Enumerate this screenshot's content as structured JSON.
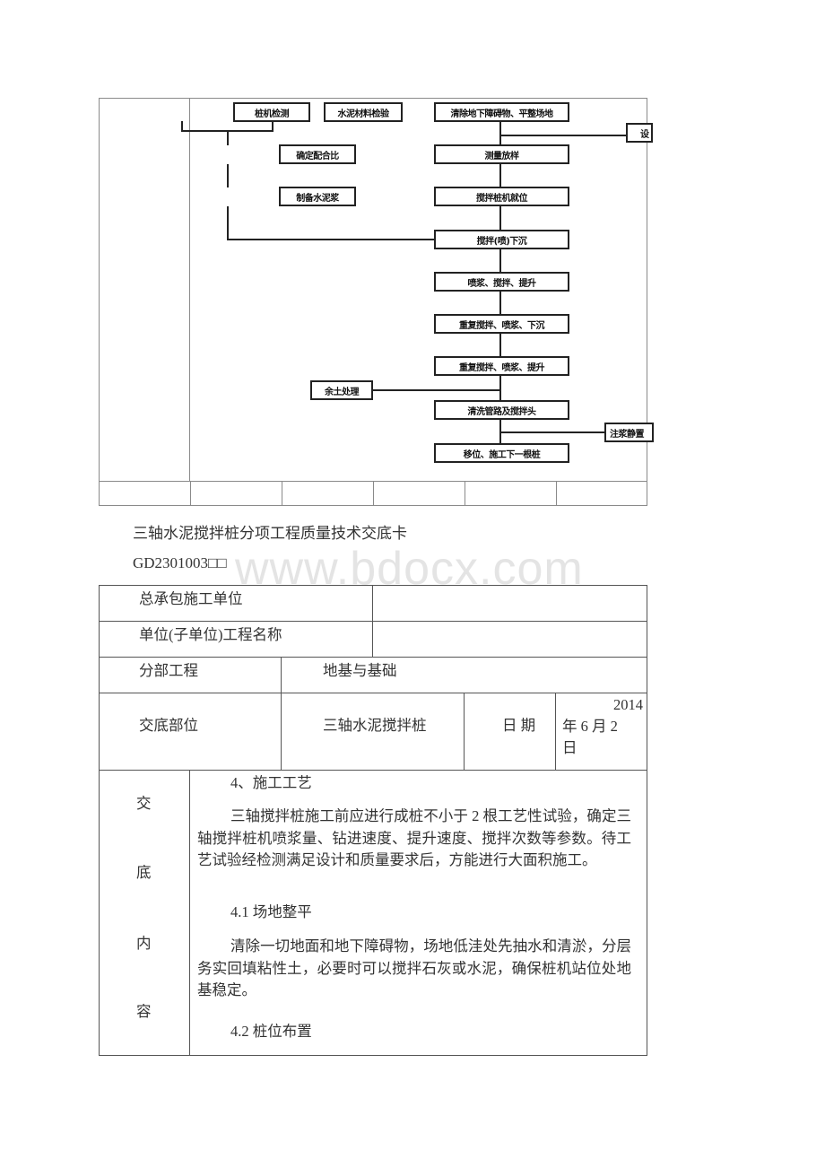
{
  "flowchart": {
    "boxes": {
      "pile_machine_check": "桩机检测",
      "cement_material_check": "水泥材料检验",
      "clear_obstacles": "清除地下障碍物、平整场地",
      "side_right_top": "设",
      "mix_ratio": "确定配合比",
      "survey_layout": "测量放样",
      "prepare_slurry": "制备水泥浆",
      "machine_in_place": "搅拌桩机就位",
      "mix_sink": "搅拌(喷)下沉",
      "spray_mix_lift": "喷浆、搅拌、提升",
      "repeat_mix_sink": "重复搅拌、喷浆、下沉",
      "repeat_mix_lift": "重复搅拌、喷浆、提升",
      "spoil_disposal": "余土处理",
      "clean_pipes": "清洗管路及搅拌头",
      "side_right_bottom": "注浆静置",
      "move_next": "移位、施工下一根桩"
    }
  },
  "document": {
    "title": "三轴水泥搅拌桩分项工程质量技术交底卡",
    "code": "GD2301003□□",
    "watermark": "www.bdocx.com"
  },
  "form": {
    "general_contractor_label": "总承包施工单位",
    "general_contractor_value": "",
    "project_name_label": "单位(子单位)工程名称",
    "project_name_value": "",
    "sub_project_label": "分部工程",
    "sub_project_value": "地基与基础",
    "location_label": "交底部位",
    "location_value": "三轴水泥搅拌桩",
    "date_label": "日 期",
    "date_line1": "2014",
    "date_line2": "年 6 月 2",
    "date_line3": "日",
    "content_label_chars": [
      "交",
      "底",
      "内",
      "容"
    ],
    "content": {
      "section4_heading": "4、施工工艺",
      "section4_para": "三轴搅拌桩施工前应进行成桩不小于 2 根工艺性试验，确定三轴搅拌桩机喷浆量、钻进速度、提升速度、搅拌次数等参数。待工艺试验经检测满足设计和质量要求后，方能进行大面积施工。",
      "section41_heading": "4.1 场地整平",
      "section41_para": "清除一切地面和地下障碍物，场地低洼处先抽水和清淤，分层务实回填粘性土，必要时可以搅拌石灰或水泥，确保桩机站位处地基稳定。",
      "section42_heading": "4.2 桩位布置"
    }
  }
}
